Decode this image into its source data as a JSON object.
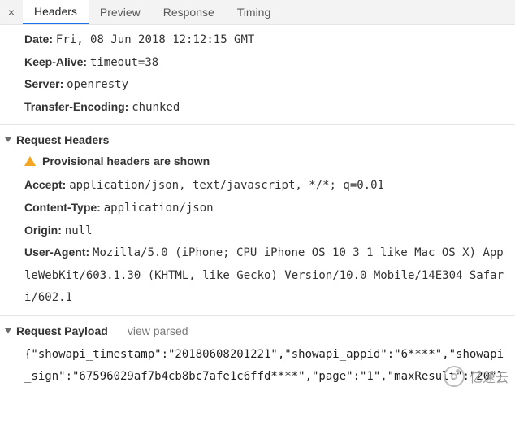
{
  "tabs": {
    "close_glyph": "×",
    "items": [
      {
        "label": "Headers",
        "active": true
      },
      {
        "label": "Preview",
        "active": false
      },
      {
        "label": "Response",
        "active": false
      },
      {
        "label": "Timing",
        "active": false
      }
    ]
  },
  "general_headers": [
    {
      "key": "Date:",
      "value": "Fri, 08 Jun 2018 12:12:15 GMT"
    },
    {
      "key": "Keep-Alive:",
      "value": "timeout=38"
    },
    {
      "key": "Server:",
      "value": "openresty"
    },
    {
      "key": "Transfer-Encoding:",
      "value": "chunked"
    }
  ],
  "request_headers": {
    "title": "Request Headers",
    "warning": "Provisional headers are shown",
    "items": [
      {
        "key": "Accept:",
        "value": "application/json, text/javascript, */*; q=0.01"
      },
      {
        "key": "Content-Type:",
        "value": "application/json"
      },
      {
        "key": "Origin:",
        "value": "null"
      },
      {
        "key": "User-Agent:",
        "value": "Mozilla/5.0 (iPhone; CPU iPhone OS 10_3_1 like Mac OS X) AppleWebKit/603.1.30 (KHTML, like Gecko) Version/10.0 Mobile/14E304 Safari/602.1"
      }
    ]
  },
  "request_payload": {
    "title": "Request Payload",
    "view_parsed": "view parsed",
    "body": "{\"showapi_timestamp\":\"20180608201221\",\"showapi_appid\":\"6****\",\"showapi_sign\":\"67596029af7b4cb8bc7afe1c6ffd****\",\"page\":\"1\",\"maxResult\":\"20\"}"
  },
  "watermark": "亿速云"
}
